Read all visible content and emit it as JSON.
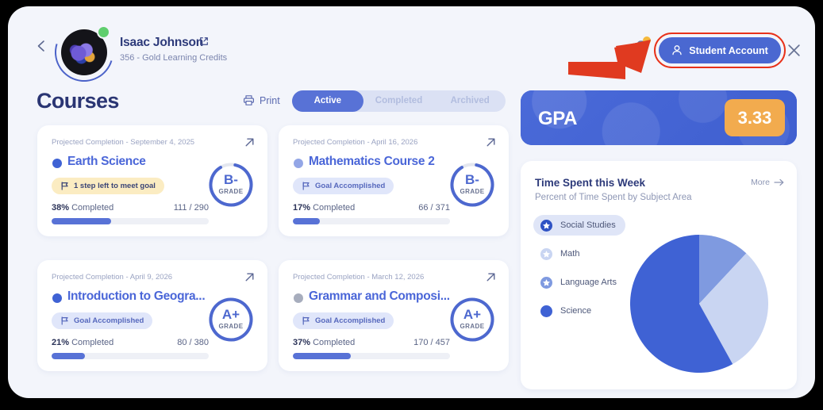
{
  "header": {
    "back_icon": "chevron-left-icon",
    "user_name": "Isaac Johnson",
    "user_name_ext_icon": "external-link-icon",
    "user_subtitle": "356 - Gold Learning Credits",
    "avatar_icon": "user-avatar",
    "status_dot_color": "#5fce6e",
    "bell_icon": "notification-bell-icon",
    "account_button_label": "Student Account",
    "account_button_icon": "user-icon",
    "account_button_color": "#4a68d1",
    "highlight_color": "#e8321a",
    "close_icon": "close-icon",
    "arrow_annotation_color": "#e03a20"
  },
  "courses_section": {
    "title": "Courses",
    "print_label": "Print",
    "print_icon": "printer-icon",
    "tabs": [
      {
        "label": "Active",
        "active": true
      },
      {
        "label": "Completed",
        "active": false
      },
      {
        "label": "Archived",
        "active": false
      }
    ],
    "cards": [
      {
        "projected": "Projected Completion - September 4, 2025",
        "name": "Earth Science",
        "dot_color": "#3f62d4",
        "badge_label": "1 step left to meet goal",
        "badge_type": "warn",
        "badge_icon": "flag-icon",
        "percent_label": "38%",
        "completed_label": "Completed",
        "fraction": "111 / 290",
        "progress": 38,
        "grade": "B-",
        "grade_sub": "GRADE",
        "ring_fill": 88,
        "ext_icon": "arrow-up-right-icon"
      },
      {
        "projected": "Projected Completion - April 16, 2026",
        "name": "Mathematics Course 2",
        "dot_color": "#93a6e6",
        "badge_label": "Goal Accomplished",
        "badge_type": "ok",
        "badge_icon": "flag-icon",
        "percent_label": "17%",
        "completed_label": "Completed",
        "fraction": "66 / 371",
        "progress": 17,
        "grade": "B-",
        "grade_sub": "GRADE",
        "ring_fill": 88,
        "ext_icon": "arrow-up-right-icon"
      },
      {
        "projected": "Projected Completion - April 9, 2026",
        "name": "Introduction to Geogra...",
        "dot_color": "#3f62d4",
        "badge_label": "Goal Accomplished",
        "badge_type": "ok",
        "badge_icon": "flag-icon",
        "percent_label": "21%",
        "completed_label": "Completed",
        "fraction": "80 / 380",
        "progress": 21,
        "grade": "A+",
        "grade_sub": "GRADE",
        "ring_fill": 100,
        "ext_icon": "arrow-up-right-icon"
      },
      {
        "projected": "Projected Completion - March 12, 2026",
        "name": "Grammar and Composi...",
        "dot_color": "#a7adbd",
        "badge_label": "Goal Accomplished",
        "badge_type": "ok",
        "badge_icon": "flag-icon",
        "percent_label": "37%",
        "completed_label": "Completed",
        "fraction": "170 / 457",
        "progress": 37,
        "grade": "A+",
        "grade_sub": "GRADE",
        "ring_fill": 100,
        "ext_icon": "arrow-up-right-icon"
      }
    ]
  },
  "gpa": {
    "label": "GPA",
    "value": "3.33",
    "value_bg": "#f2ab4e",
    "card_bg": "#4568d6"
  },
  "time_spent": {
    "title": "Time Spent this Week",
    "subtitle": "Percent of Time Spent by Subject Area",
    "more_label": "More",
    "more_icon": "arrow-right-icon"
  },
  "chart_data": {
    "type": "pie",
    "title": "Time Spent this Week",
    "subtitle": "Percent of Time Spent by Subject Area",
    "legend_position": "left",
    "categories": [
      "Social Studies",
      "Math",
      "Language Arts",
      "Science"
    ],
    "values": [
      0,
      12,
      30,
      58
    ],
    "colors": [
      "#2f52c4",
      "#c9d5f2",
      "#7f9ae0",
      "#3f62d4"
    ],
    "legend": [
      {
        "label": "Social Studies",
        "icon": "star-filled-icon",
        "color": "#2f52c4",
        "selected": true
      },
      {
        "label": "Math",
        "icon": "star-outline-icon",
        "color": "#c9d5f2",
        "selected": false
      },
      {
        "label": "Language Arts",
        "icon": "star-outline-icon",
        "color": "#7f9ae0",
        "selected": false
      },
      {
        "label": "Science",
        "icon": "circle-filled-icon",
        "color": "#3f62d4",
        "selected": false
      }
    ],
    "slices": [
      {
        "name": "Math",
        "percent": 12,
        "color": "#7f9ae0",
        "start_deg": 0,
        "end_deg": 43
      },
      {
        "name": "Language Arts",
        "percent": 30,
        "color": "#c9d5f2",
        "start_deg": 43,
        "end_deg": 151
      },
      {
        "name": "Science",
        "percent": 58,
        "color": "#3f62d4",
        "start_deg": 151,
        "end_deg": 360
      }
    ]
  }
}
